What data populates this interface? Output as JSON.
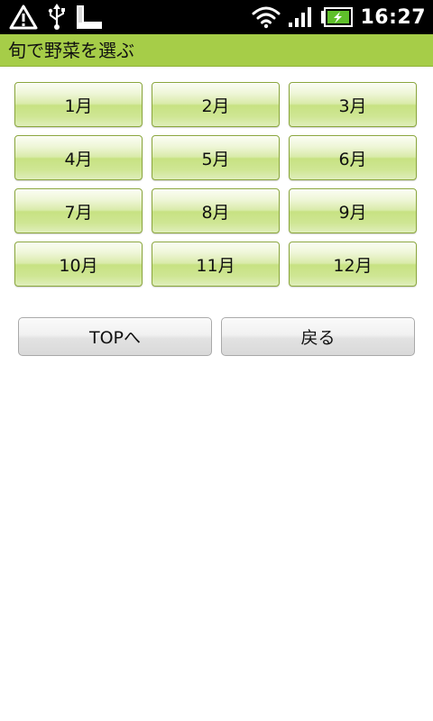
{
  "status_bar": {
    "time": "16:27",
    "icons": [
      "warning-icon",
      "usb-icon",
      "sd-card-icon",
      "wifi-icon",
      "signal-icon",
      "battery-charging-icon"
    ],
    "background": "#000000"
  },
  "title_bar": {
    "title": "旬で野菜を選ぶ",
    "color": "#a6cd48"
  },
  "months": [
    "1月",
    "2月",
    "3月",
    "4月",
    "5月",
    "6月",
    "7月",
    "8月",
    "9月",
    "10月",
    "11月",
    "12月"
  ],
  "nav": {
    "top_label": "TOPへ",
    "back_label": "戻る"
  }
}
